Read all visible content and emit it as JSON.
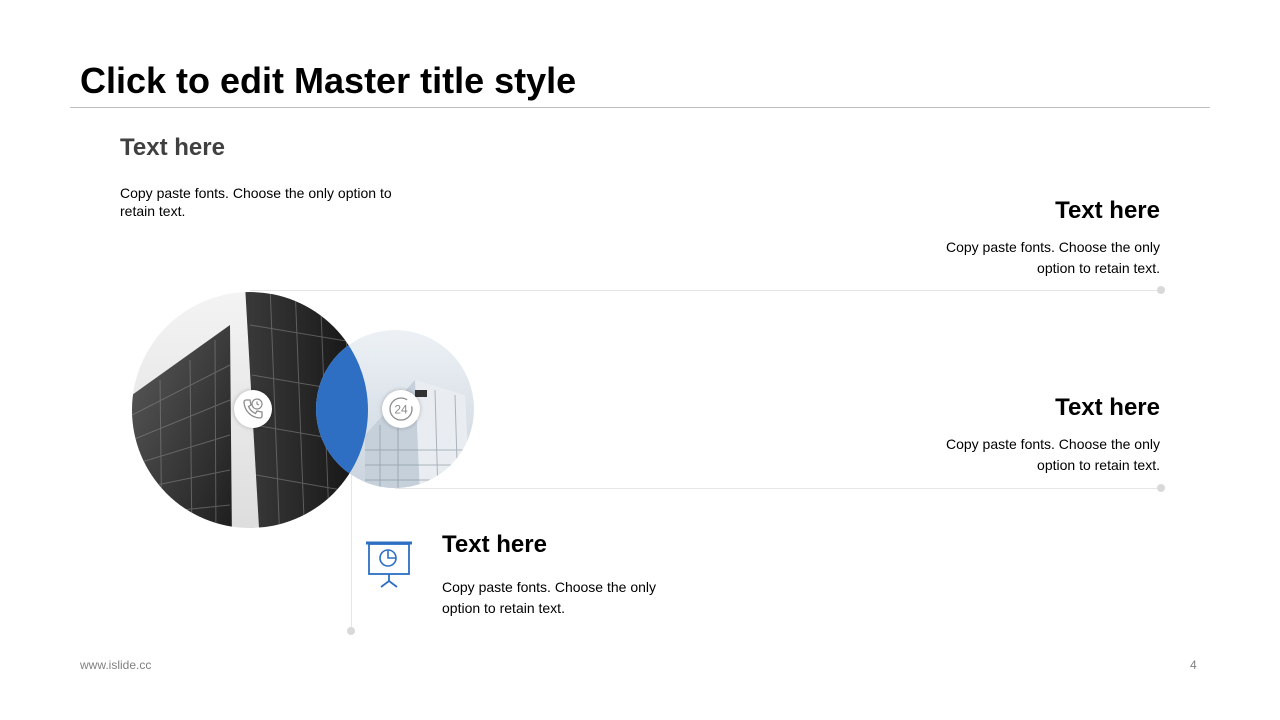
{
  "slide": {
    "title": "Click to edit Master title style",
    "footer_url": "www.islide.cc",
    "page_number": "4"
  },
  "items": [
    {
      "heading": "Text here",
      "body": "Copy paste fonts. Choose the only option to retain text."
    },
    {
      "heading": "Text here",
      "body": "Copy paste fonts. Choose the only option to retain text."
    },
    {
      "heading": "Text here",
      "body": "Copy paste fonts. Choose the only option to retain text."
    },
    {
      "heading": "Text here",
      "body": "Copy paste fonts. Choose the only option to retain text."
    }
  ],
  "colors": {
    "accent": "#2e6fc4",
    "divider": "#bfbfbf",
    "connector": "#e6e6e6",
    "footer_text": "#808080"
  },
  "icons": [
    "phone-clock-icon",
    "24-hour-icon",
    "presentation-chart-icon"
  ]
}
